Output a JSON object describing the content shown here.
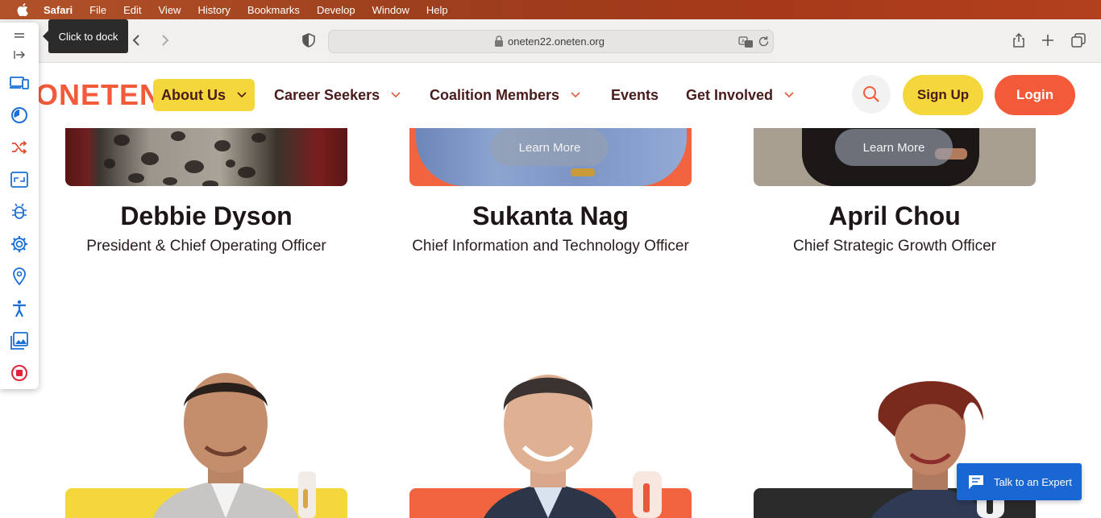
{
  "menubar": {
    "app": "Safari",
    "items": [
      "File",
      "Edit",
      "View",
      "History",
      "Bookmarks",
      "Develop",
      "Window",
      "Help"
    ]
  },
  "toolbar": {
    "url": "oneten22.oneten.org"
  },
  "sidepanel": {
    "tooltip": "Click to dock",
    "icons": [
      "menu-icon",
      "collapse-arrow-icon",
      "responsive-devices-icon",
      "color-wheel-icon",
      "shuffle-icon",
      "screen-ruler-icon",
      "bug-icon",
      "settings-gear-icon",
      "location-pin-icon",
      "accessibility-icon",
      "image-gallery-icon",
      "stop-record-icon"
    ]
  },
  "site": {
    "logo": "ONETEN",
    "nav": [
      {
        "label": "About Us",
        "dropdown": true,
        "active": true
      },
      {
        "label": "Career Seekers",
        "dropdown": true
      },
      {
        "label": "Coalition Members",
        "dropdown": true
      },
      {
        "label": "Events",
        "dropdown": false
      },
      {
        "label": "Get Involved",
        "dropdown": true
      }
    ],
    "signup": "Sign Up",
    "login": "Login",
    "colors": {
      "yellow": "#f4d73b",
      "orange": "#f25a3a",
      "dark": "#4a1b1b"
    }
  },
  "people": [
    {
      "name": "Debbie Dyson",
      "title": "President & Chief Operating Officer",
      "learn_more": ""
    },
    {
      "name": "Sukanta Nag",
      "title": "Chief Information and Technology Officer",
      "learn_more": "Learn More"
    },
    {
      "name": "April Chou",
      "title": "Chief Strategic Growth Officer",
      "learn_more": "Learn More"
    }
  ],
  "chat": {
    "label": "Talk to an Expert"
  }
}
